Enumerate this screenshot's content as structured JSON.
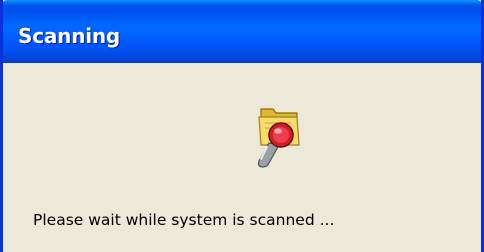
{
  "window": {
    "title": "Scanning"
  },
  "content": {
    "icon": "folder-with-magnifier-icon",
    "message": "Please wait while system is scanned ..."
  },
  "colors": {
    "titlebar": "#0058ee",
    "body": "#ece9d8",
    "title_text": "#ffffff"
  }
}
